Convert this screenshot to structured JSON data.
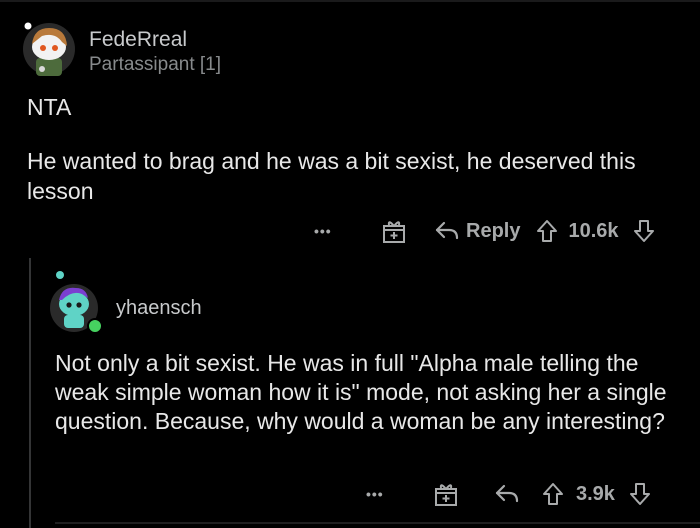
{
  "comment1": {
    "username": "FedeRreal",
    "flair": "Partassipant [1]",
    "paragraphs": [
      "NTA",
      "He wanted to brag and he was a bit sexist, he deserved this lesson"
    ],
    "actions": {
      "more_label": "•••",
      "reply_label": "Reply",
      "score": "10.6k"
    }
  },
  "comment2": {
    "username": "yhaensch",
    "body": "Not only a bit sexist. He was in full \"Alpha male telling the weak simple woman how it is\" mode, not asking her a single question. Because, why would a woman be any interesting?",
    "actions": {
      "more_label": "•••",
      "score": "3.9k"
    }
  },
  "colors": {
    "background": "#000000",
    "text": "#e8e8e8",
    "muted": "#878a8c",
    "online": "#46d160"
  },
  "icons": [
    "award-icon",
    "reply-icon",
    "upvote-icon",
    "downvote-icon",
    "more-icon"
  ]
}
